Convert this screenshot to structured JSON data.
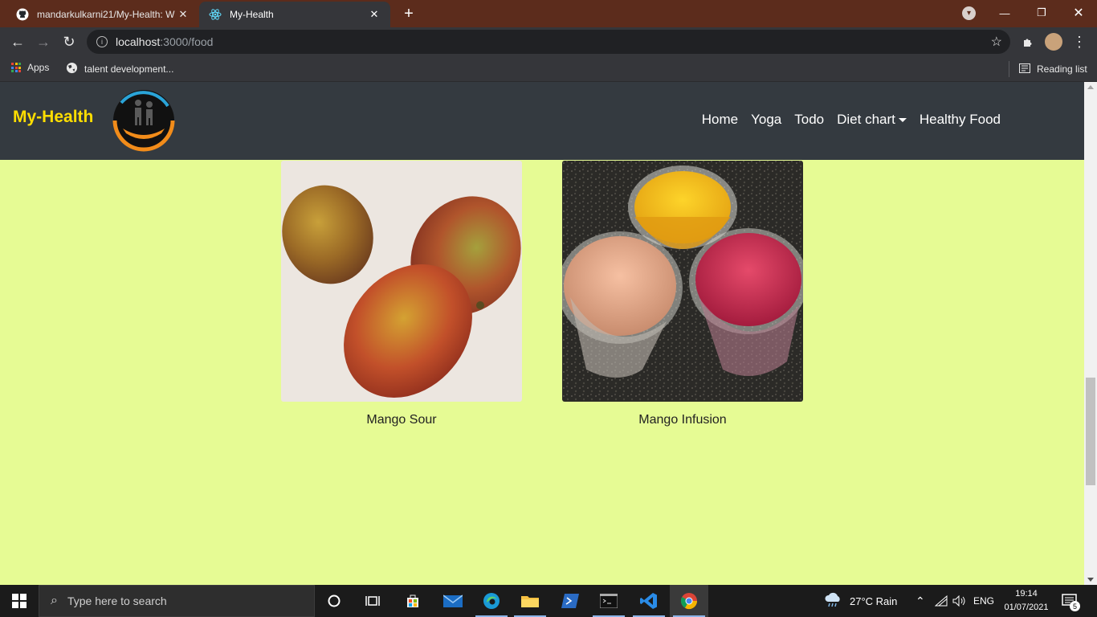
{
  "browser": {
    "tabs": [
      {
        "title": "mandarkulkarni21/My-Health: W",
        "active": false
      },
      {
        "title": "My-Health",
        "active": true
      }
    ],
    "url_host": "localhost",
    "url_path": ":3000/food",
    "bookmarks": [
      {
        "label": "Apps"
      },
      {
        "label": "talent development..."
      }
    ],
    "reading_list": "Reading list"
  },
  "site": {
    "brand": "My-Health",
    "nav": [
      {
        "label": "Home"
      },
      {
        "label": "Yoga"
      },
      {
        "label": "Todo"
      },
      {
        "label": "Diet chart",
        "dropdown": true
      },
      {
        "label": "Healthy Food"
      }
    ],
    "colors": {
      "nav_bg": "#343a40",
      "brand": "#ffde00",
      "page_bg": "#e6fb94"
    },
    "foods": [
      {
        "name": "Mango Sour"
      },
      {
        "name": "Mango Infusion"
      }
    ]
  },
  "taskbar": {
    "search_placeholder": "Type here to search",
    "weather": "27°C  Rain",
    "language": "ENG",
    "time": "19:14",
    "date": "01/07/2021",
    "notifications": "5"
  }
}
